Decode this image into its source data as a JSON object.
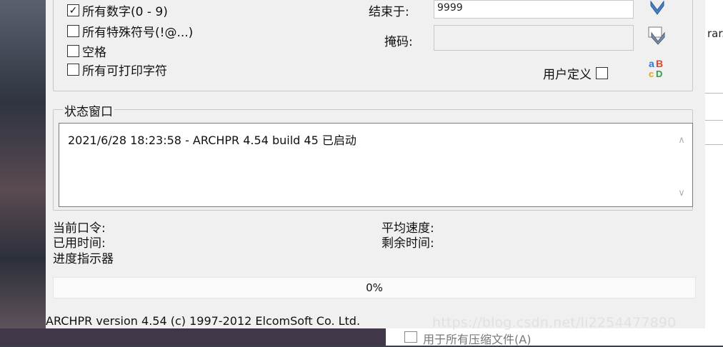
{
  "background": {
    "right_fragment": "rar.",
    "below_option": "用于所有压缩文件(A)"
  },
  "charset": {
    "digits": "所有数字(0 - 9)",
    "special": "所有特殊符号(!@...)",
    "space": "空格",
    "printable": "所有可打印字符",
    "digits_checked": true,
    "special_checked": false,
    "space_checked": false,
    "printable_checked": false
  },
  "fields": {
    "end_label": "结束于:",
    "end_value": "9999",
    "mask_label": "掩码:",
    "mask_value": "",
    "user_defined_label": "用户定义",
    "user_defined_checked": false
  },
  "icons": {
    "down_arrow": "arrow-down-icon",
    "mask_arrow": "mask-icon",
    "custom_charset": "abcd-charset-icon"
  },
  "status": {
    "title": "状态窗口",
    "log": [
      "2021/6/28 18:23:58 - ARCHPR 4.54 build 45 已启动"
    ]
  },
  "stats": {
    "current_password_label": "当前口令:",
    "elapsed_label": "已用时间:",
    "progress_label": "进度指示器",
    "avg_speed_label": "平均速度:",
    "remaining_label": "剩余时间:"
  },
  "progress": {
    "value": 0,
    "text": "0%"
  },
  "statusbar": {
    "text": "ARCHPR version 4.54 (c) 1997-2012 ElcomSoft Co. Ltd."
  },
  "watermark": "https://blog.csdn.net/li2254477890",
  "colors": {
    "window_bg": "#f0f0f0",
    "progress_fill": "#2f9e44"
  }
}
